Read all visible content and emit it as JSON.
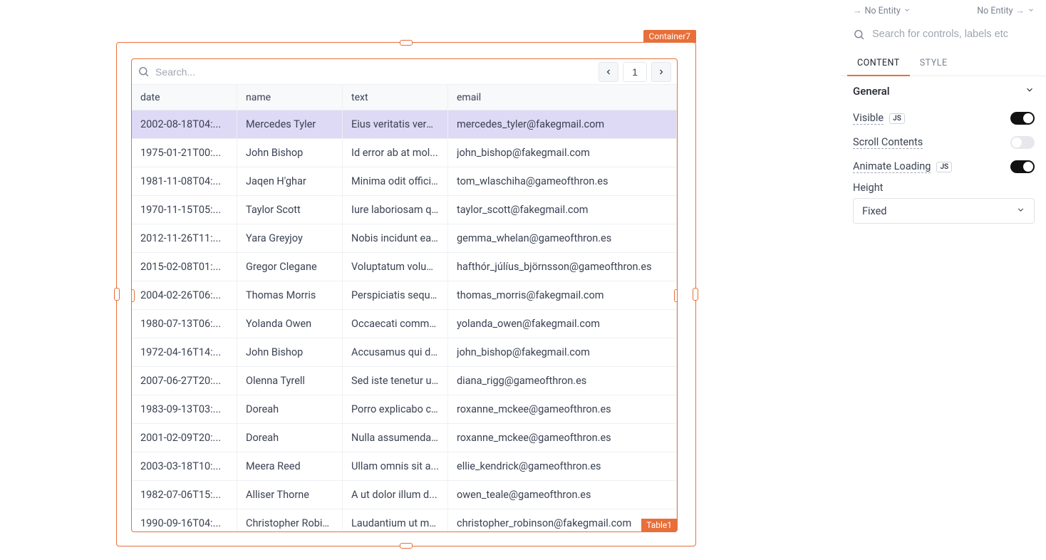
{
  "canvas": {
    "container_label": "Container7",
    "table_label": "Table1"
  },
  "table": {
    "search_placeholder": "Search...",
    "page": "1",
    "columns": [
      "date",
      "name",
      "text",
      "email"
    ],
    "rows": [
      {
        "date": "2002-08-18T04:...",
        "name": "Mercedes Tyler",
        "text": "Eius veritatis vero ...",
        "email": "mercedes_tyler@fakegmail.com",
        "sel": true
      },
      {
        "date": "1975-01-21T00:...",
        "name": "John Bishop",
        "text": "Id error ab at mol...",
        "email": "john_bishop@fakegmail.com"
      },
      {
        "date": "1981-11-08T04:...",
        "name": "Jaqen H'ghar",
        "text": "Minima odit officii...",
        "email": "tom_wlaschiha@gameofthron.es"
      },
      {
        "date": "1970-11-15T05:...",
        "name": "Taylor Scott",
        "text": "Iure laboriosam q...",
        "email": "taylor_scott@fakegmail.com"
      },
      {
        "date": "2012-11-26T11:...",
        "name": "Yara Greyjoy",
        "text": "Nobis incidunt ea ...",
        "email": "gemma_whelan@gameofthron.es"
      },
      {
        "date": "2015-02-08T01:...",
        "name": "Gregor Clegane",
        "text": "Voluptatum volup...",
        "email": "hafthór_júlíus_björnsson@gameofthron.es"
      },
      {
        "date": "2004-02-26T06:...",
        "name": "Thomas Morris",
        "text": "Perspiciatis sequi ...",
        "email": "thomas_morris@fakegmail.com"
      },
      {
        "date": "1980-07-13T06:...",
        "name": "Yolanda Owen",
        "text": "Occaecati commo...",
        "email": "yolanda_owen@fakegmail.com"
      },
      {
        "date": "1972-04-16T14:...",
        "name": "John Bishop",
        "text": "Accusamus qui di...",
        "email": "john_bishop@fakegmail.com"
      },
      {
        "date": "2007-06-27T20:...",
        "name": "Olenna Tyrell",
        "text": "Sed iste tenetur u...",
        "email": "diana_rigg@gameofthron.es"
      },
      {
        "date": "1983-09-13T03:...",
        "name": "Doreah",
        "text": "Porro explicabo c...",
        "email": "roxanne_mckee@gameofthron.es"
      },
      {
        "date": "2001-02-09T20:...",
        "name": "Doreah",
        "text": "Nulla assumenda ...",
        "email": "roxanne_mckee@gameofthron.es"
      },
      {
        "date": "2003-03-18T10:...",
        "name": "Meera Reed",
        "text": "Ullam omnis sit a...",
        "email": "ellie_kendrick@gameofthron.es"
      },
      {
        "date": "1982-07-06T15:...",
        "name": "Alliser Thorne",
        "text": "A ut dolor illum d...",
        "email": "owen_teale@gameofthron.es"
      },
      {
        "date": "1990-09-16T04:...",
        "name": "Christopher Robin...",
        "text": "Laudantium ut mo...",
        "email": "christopher_robinson@fakegmail.com"
      }
    ]
  },
  "panel": {
    "entity_in": "No Entity",
    "entity_out": "No Entity",
    "search_placeholder": "Search for controls, labels etc",
    "tabs": {
      "content": "CONTENT",
      "style": "STYLE"
    },
    "section": "General",
    "props": {
      "visible": "Visible",
      "scroll": "Scroll Contents",
      "animate": "Animate Loading",
      "js": "JS"
    },
    "height_label": "Height",
    "height_value": "Fixed"
  }
}
